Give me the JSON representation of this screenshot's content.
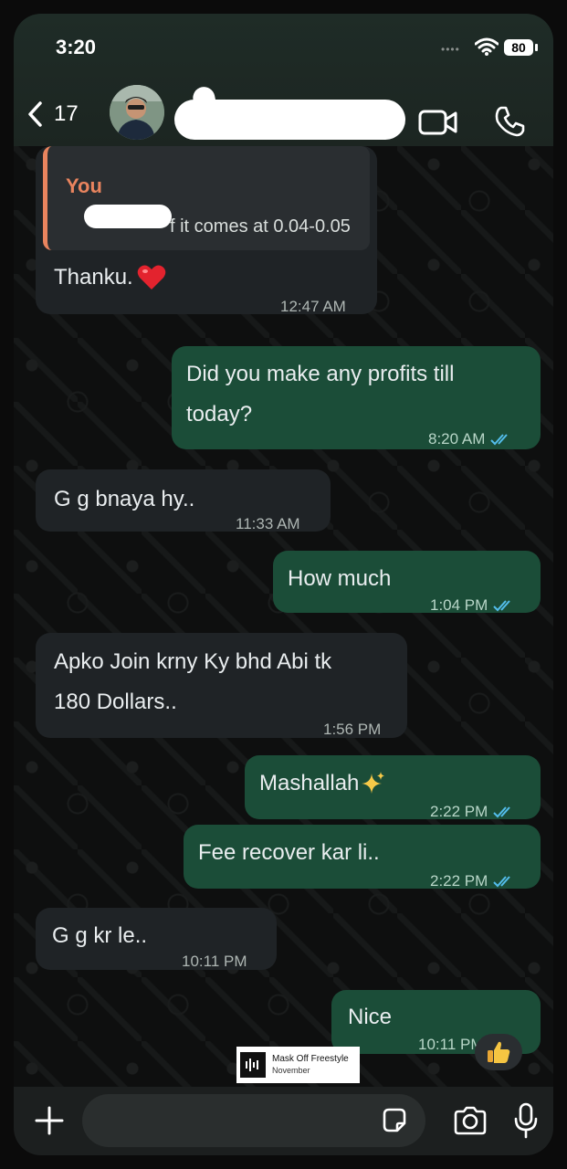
{
  "status_bar": {
    "time": "3:20",
    "battery": "80"
  },
  "header": {
    "back_count": "17"
  },
  "messages": [
    {
      "direction": "in",
      "reply_author": "You",
      "reply_text": "f it comes at 0.04-0.05",
      "text": "Thanku.",
      "emoji": "heart",
      "time": "12:47 AM"
    },
    {
      "direction": "out",
      "line1": "Did you make any profits till",
      "line2": "today?",
      "time": "8:20 AM",
      "status": "read"
    },
    {
      "direction": "in",
      "text": "G g bnaya hy..",
      "time": "11:33 AM"
    },
    {
      "direction": "out",
      "text": "How much",
      "time": "1:04 PM",
      "status": "read"
    },
    {
      "direction": "in",
      "line1": "Apko Join krny Ky bhd Abi tk",
      "line2": "180 Dollars..",
      "time": "1:56 PM"
    },
    {
      "direction": "out",
      "text": "Mashallah",
      "emoji": "sparkles",
      "time": "2:22 PM",
      "status": "read"
    },
    {
      "direction": "out",
      "text": "Fee recover kar li..",
      "time": "2:22 PM",
      "status": "read"
    },
    {
      "direction": "in",
      "text": "G g kr le..",
      "time": "10:11 PM"
    },
    {
      "direction": "out",
      "text": "Nice",
      "time": "10:11 PM",
      "status": "read",
      "reaction": "thumbs-up"
    }
  ],
  "music_card": {
    "title": "Mask Off Freestyle",
    "artist": "November"
  },
  "composer": {
    "placeholder": ""
  },
  "colors": {
    "incoming": "#1f2326",
    "outgoing": "#1b4d38",
    "read_ticks": "#53bdeb",
    "reply_accent": "#e9845e"
  }
}
